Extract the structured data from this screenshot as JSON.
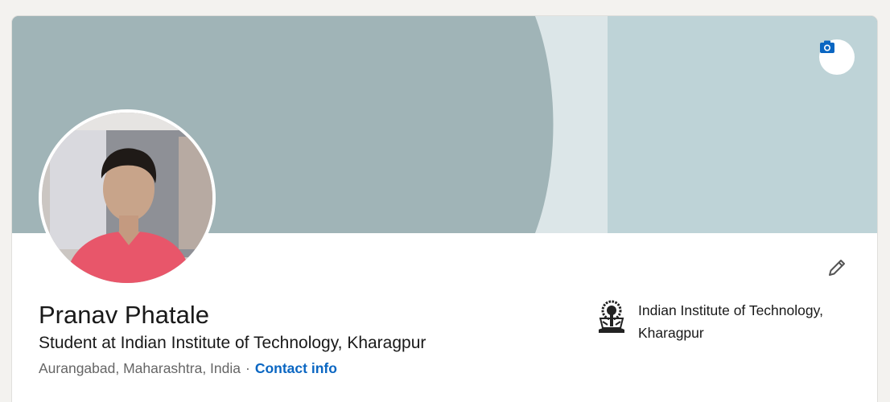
{
  "profile": {
    "name": "Pranav Phatale",
    "headline": "Student at Indian Institute of Technology, Kharagpur",
    "location": "Aurangabad, Maharashtra, India",
    "separator": "·",
    "contact_info_label": "Contact info"
  },
  "education": {
    "school_name": "Indian Institute of Technology, Kharagpur",
    "logo_icon": "iit-kharagpur-crest-icon"
  },
  "icons": {
    "cover_edit": "camera-icon",
    "intro_edit": "pencil-icon"
  },
  "colors": {
    "background": "#f3f2ef",
    "cover_base": "#a0b4b7",
    "cover_light": "#dce6e8",
    "cover_right": "#bed3d7",
    "link": "#0a66c2",
    "text_primary": "#191919",
    "text_secondary": "#666666",
    "avatar_shirt": "#e8566a"
  }
}
